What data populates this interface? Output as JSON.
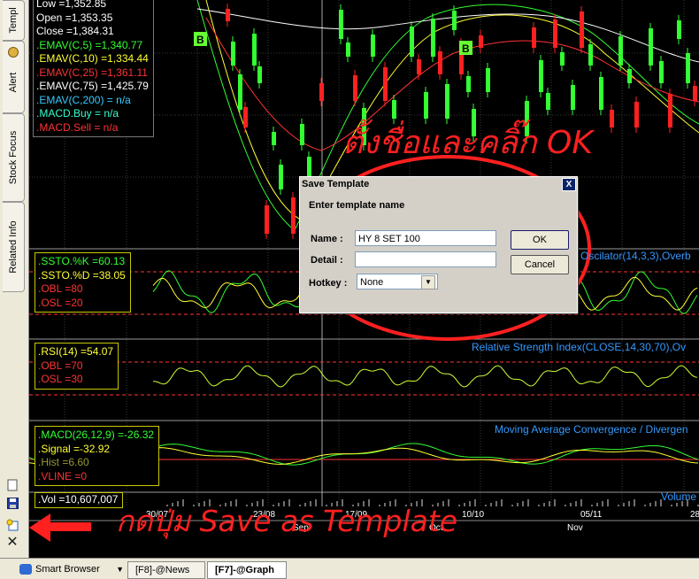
{
  "left_tabs": [
    {
      "label": "Templ"
    },
    {
      "label": "Alert"
    },
    {
      "label": "Stock Focus"
    },
    {
      "label": "Related Info"
    }
  ],
  "price_legend": [
    {
      "text": "Low   =1,352.85",
      "color": "#FFFFFF"
    },
    {
      "text": "Open  =1,353.35",
      "color": "#FFFFFF"
    },
    {
      "text": "Close  =1,384.31",
      "color": "#FFFFFF"
    },
    {
      "text": ".EMAV(C,5)    =1,340.77",
      "color": "#33FF33"
    },
    {
      "text": ".EMAV(C,10)   =1,334.44",
      "color": "#FFFF33"
    },
    {
      "text": ".EMAV(C,25)   =1,361.11",
      "color": "#FF3333"
    },
    {
      "text": ".EMAV(C,75)   =1,425.79",
      "color": "#FFFFFF"
    },
    {
      "text": ".EMAV(C,200)   = n/a",
      "color": "#33CCFF"
    },
    {
      "text": ".MACD.Buy   = n/a",
      "color": "#33FFCC"
    },
    {
      "text": ".MACD.Sell   = n/a",
      "color": "#FF3333"
    }
  ],
  "sto_legend": [
    {
      "text": ".SSTO.%K    =60.13",
      "color": "#33FF33"
    },
    {
      "text": ".SSTO.%D    =38.05",
      "color": "#FFFF33"
    },
    {
      "text": ".OBL    =80",
      "color": "#FF3333"
    },
    {
      "text": ".OSL    =20",
      "color": "#FF3333"
    }
  ],
  "rsi_legend": [
    {
      "text": ".RSI(14)    =54.07",
      "color": "#FFFF33"
    },
    {
      "text": ".OBL    =70",
      "color": "#FF3333"
    },
    {
      "text": ".OSL    =30",
      "color": "#FF3333"
    }
  ],
  "macd_legend": [
    {
      "text": ".MACD(26,12,9)    =-26.32",
      "color": "#33FF33"
    },
    {
      "text": ".Signal   =-32.92",
      "color": "#FFFF33"
    },
    {
      "text": ".Hist  =6.60",
      "color": "#999933"
    },
    {
      "text": ".VLINE    =0",
      "color": "#FF3333"
    }
  ],
  "vol_legend": [
    {
      "text": ".Vol   =10,607,007",
      "color": "#FFFFFF"
    }
  ],
  "panel_titles": {
    "oscillator": "Oscilator(14,3,3),Overb",
    "rsi": "Relative Strength Index(CLOSE,14,30,70),Ov",
    "macd": "Moving Average Convergence / Divergen",
    "volume": "Volume"
  },
  "signal_badges": [
    "B",
    "B"
  ],
  "date_labels": [
    "30/07",
    "23/08",
    "17/09",
    "10/10",
    "05/11",
    "28"
  ],
  "month_labels": [
    "Sep",
    "Oct",
    "Nov"
  ],
  "annotations": {
    "top": "ตั้งชื่อและคลิ๊ก OK",
    "bottom": "กดปุ่ม  Save as Template"
  },
  "dialog": {
    "title": "Save Template",
    "heading": "Enter template name",
    "name_label": "Name :",
    "name_value": "HY 8 SET 100",
    "detail_label": "Detail :",
    "detail_value": "",
    "hotkey_label": "Hotkey :",
    "hotkey_value": "None",
    "ok": "OK",
    "cancel": "Cancel",
    "close": "X"
  },
  "bottom_tabs": {
    "smart_browser": "Smart Browser",
    "news": "[F8]-@News",
    "graph": "[F7]-@Graph"
  },
  "colors": {
    "annotation": "#FF2020",
    "ema5": "#33FF33",
    "ema10": "#FFFF33",
    "ema25": "#FF3333",
    "ema75": "#FFFFFF",
    "candle_up": "#33FF33",
    "candle_down": "#FF2020",
    "panel_title": "#3399FF",
    "legend_border": "#C8C800"
  }
}
